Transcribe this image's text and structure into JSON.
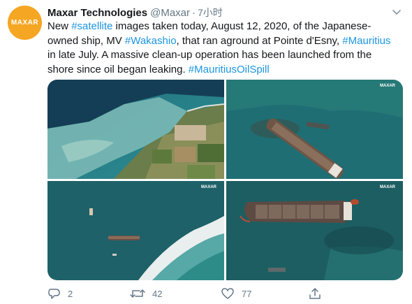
{
  "author": {
    "avatar_text": "MAXAR",
    "avatar_color": "#f5a623",
    "name": "Maxar Technologies",
    "handle": "@Maxar",
    "separator": "·",
    "time": "7小时"
  },
  "menu": {
    "icon": "chevron-down-icon"
  },
  "tweet": {
    "t1": "New ",
    "tag_satellite": "#satellite",
    "t2": " images taken today, August 12, 2020, of the Japanese-owned ship, MV ",
    "tag_wakashio": "#Wakashio",
    "t3": ", that ran aground at Pointe d'Esny, ",
    "tag_mauritius": "#Mauritius",
    "t4": " in late July. A massive clean-up operation has been launched from the shore since oil began leaking. ",
    "tag_oilspill": "#MauritiusOilSpill",
    "link_color": "#1b95e0"
  },
  "media": {
    "watermark": "MAXAR",
    "images": [
      "coastline-overview",
      "ship-aground-wide",
      "reef-and-ship-overview",
      "ship-closeup"
    ]
  },
  "actions": {
    "reply": {
      "icon": "reply-icon",
      "count": "2"
    },
    "retweet": {
      "icon": "retweet-icon",
      "count": "42"
    },
    "like": {
      "icon": "heart-icon",
      "count": "77"
    },
    "share": {
      "icon": "share-icon"
    }
  }
}
